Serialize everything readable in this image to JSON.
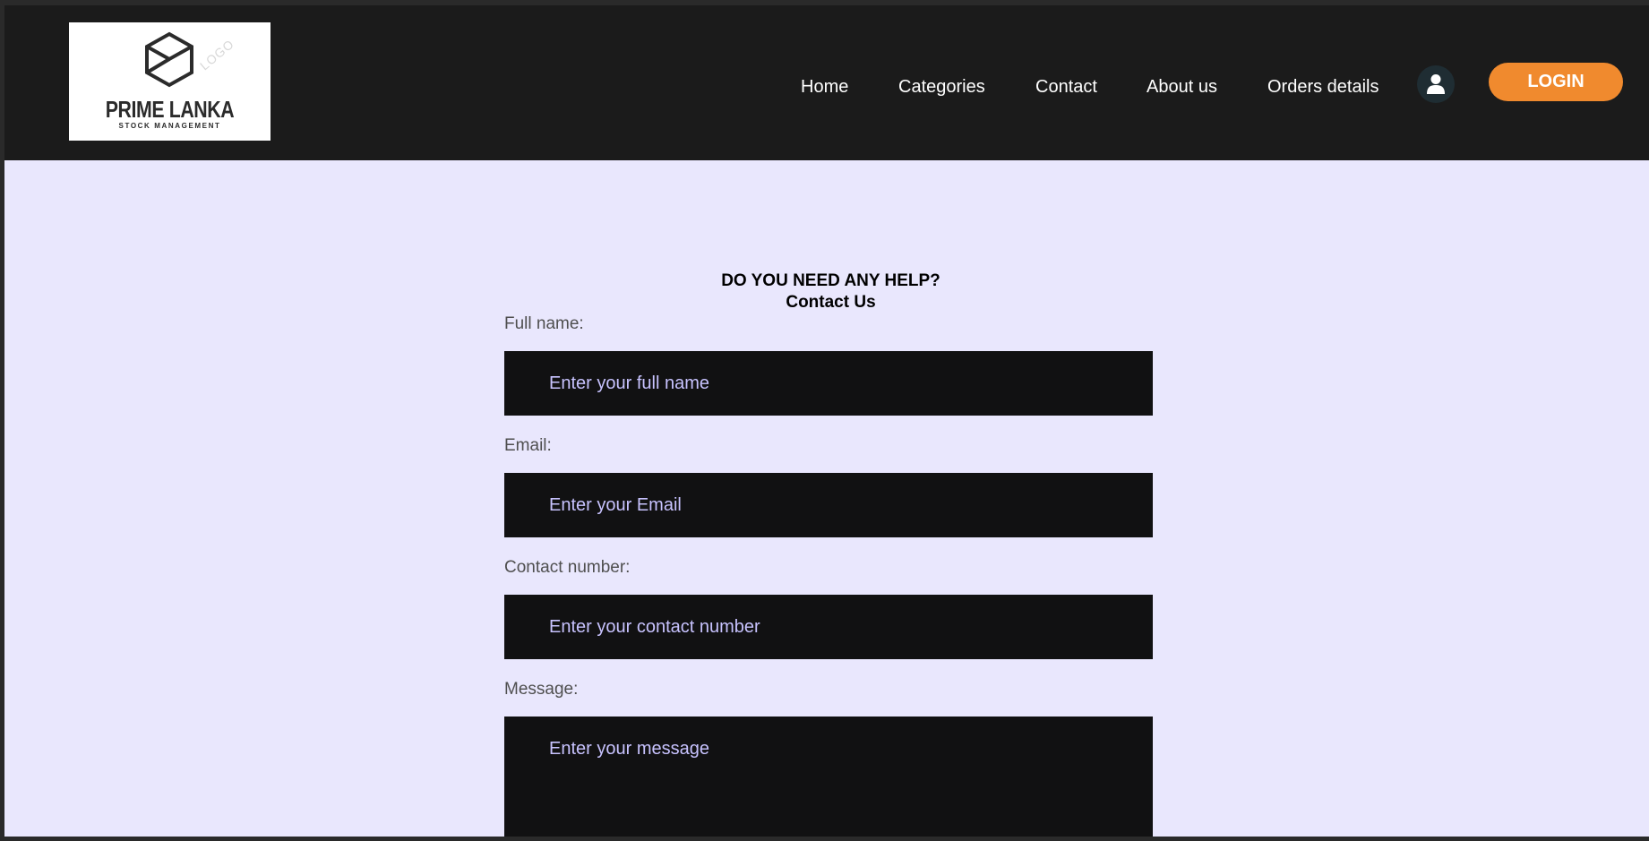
{
  "header": {
    "logo": {
      "brand": "PRIME LANKA",
      "tagline": "STOCK MANAGEMENT",
      "watermark": "LOGO"
    },
    "nav": {
      "home": "Home",
      "categories": "Categories",
      "contact": "Contact",
      "about": "About us",
      "orders": "Orders details"
    },
    "user_icon": "user-icon",
    "login_label": "LOGIN"
  },
  "contact_form": {
    "heading_line1": "DO YOU NEED ANY HELP?",
    "heading_line2": "Contact Us",
    "full_name": {
      "label": "Full name:",
      "placeholder": "Enter your full name"
    },
    "email": {
      "label": "Email:",
      "placeholder": "Enter your Email"
    },
    "contact_number": {
      "label": "Contact number:",
      "placeholder": "Enter your contact number"
    },
    "message": {
      "label": "Message:",
      "placeholder": "Enter your message"
    }
  },
  "colors": {
    "header_bg": "#1b1b1b",
    "page_bg": "#e9e7fd",
    "accent": "#f08a2e",
    "input_bg": "#111112",
    "placeholder_text": "#c8c3ff"
  }
}
